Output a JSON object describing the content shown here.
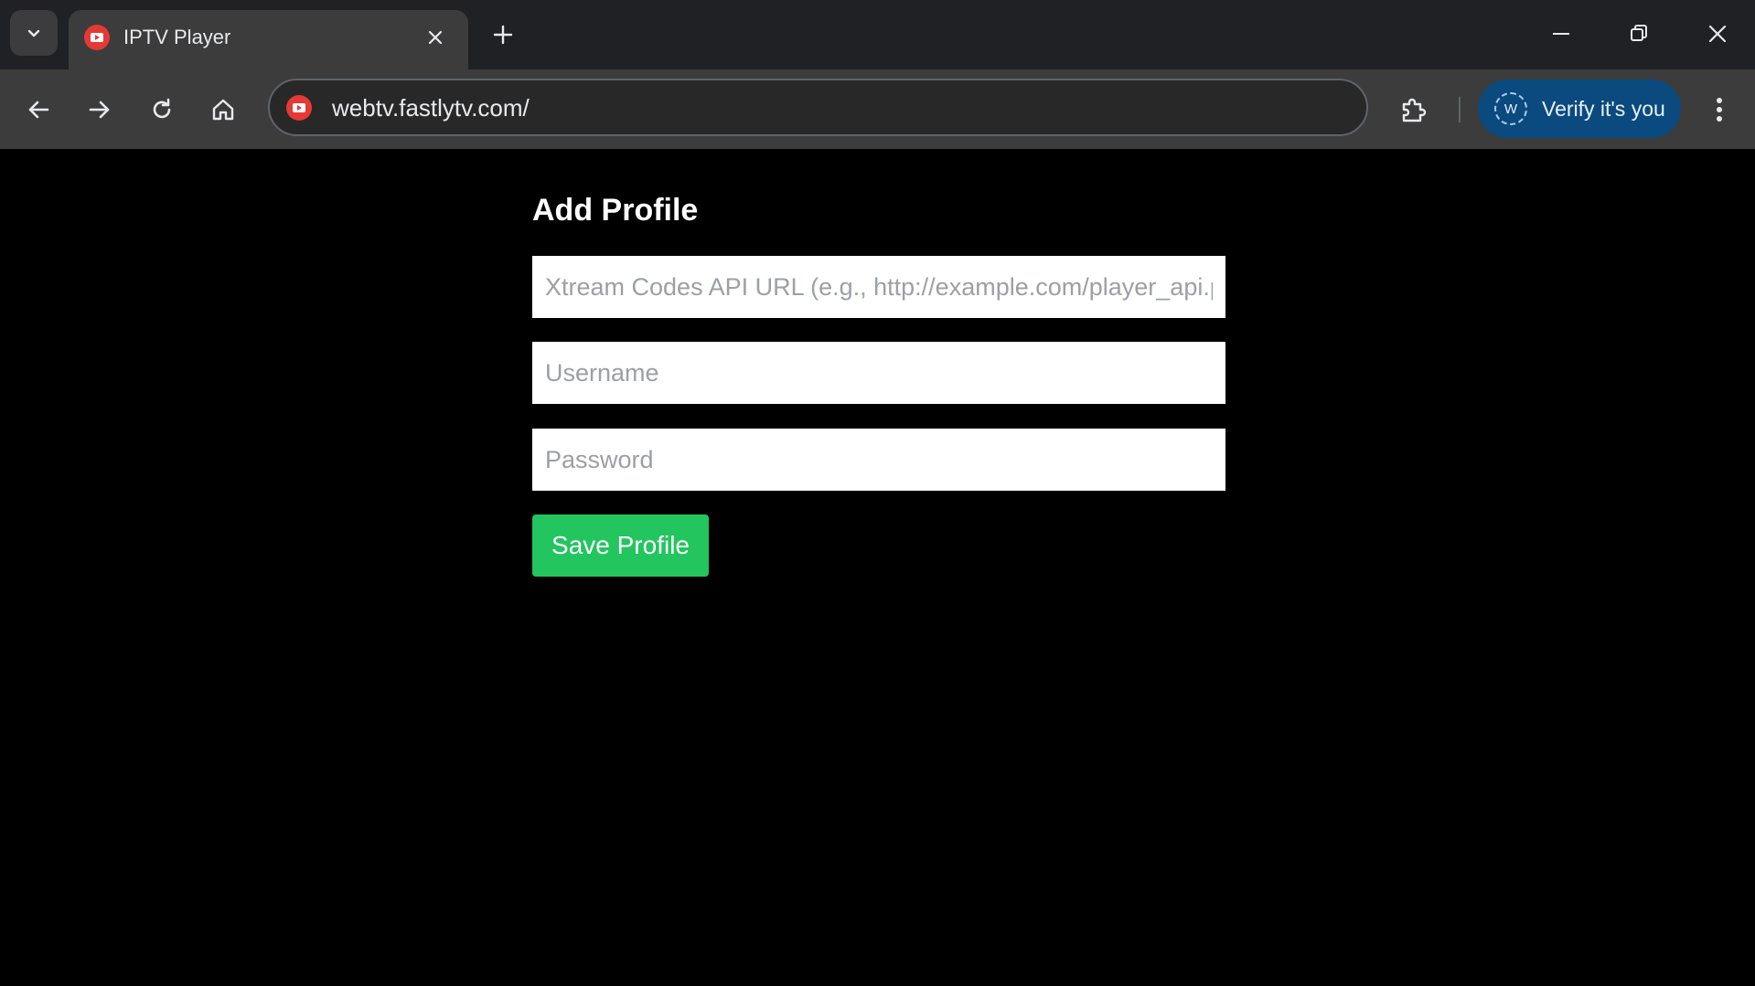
{
  "browser": {
    "tab": {
      "title": "IPTV Player",
      "favicon": "tv-play-icon"
    },
    "address_bar": {
      "url": "webtv.fastlytv.com/"
    },
    "profile_chip": {
      "avatar_letter": "W",
      "label": "Verify it's you"
    }
  },
  "page": {
    "title": "Add Profile",
    "form": {
      "api_url": {
        "value": "",
        "placeholder": "Xtream Codes API URL (e.g., http://example.com/player_api.php)"
      },
      "username": {
        "value": "",
        "placeholder": "Username"
      },
      "password": {
        "value": "",
        "placeholder": "Password"
      },
      "submit_label": "Save Profile"
    }
  },
  "colors": {
    "page_background": "#000000",
    "tabstrip": "#202124",
    "toolbar": "#3c3c3c",
    "profile_chip": "#0b4a7e",
    "save_button": "#22c55e",
    "favicon": "#e53935"
  }
}
